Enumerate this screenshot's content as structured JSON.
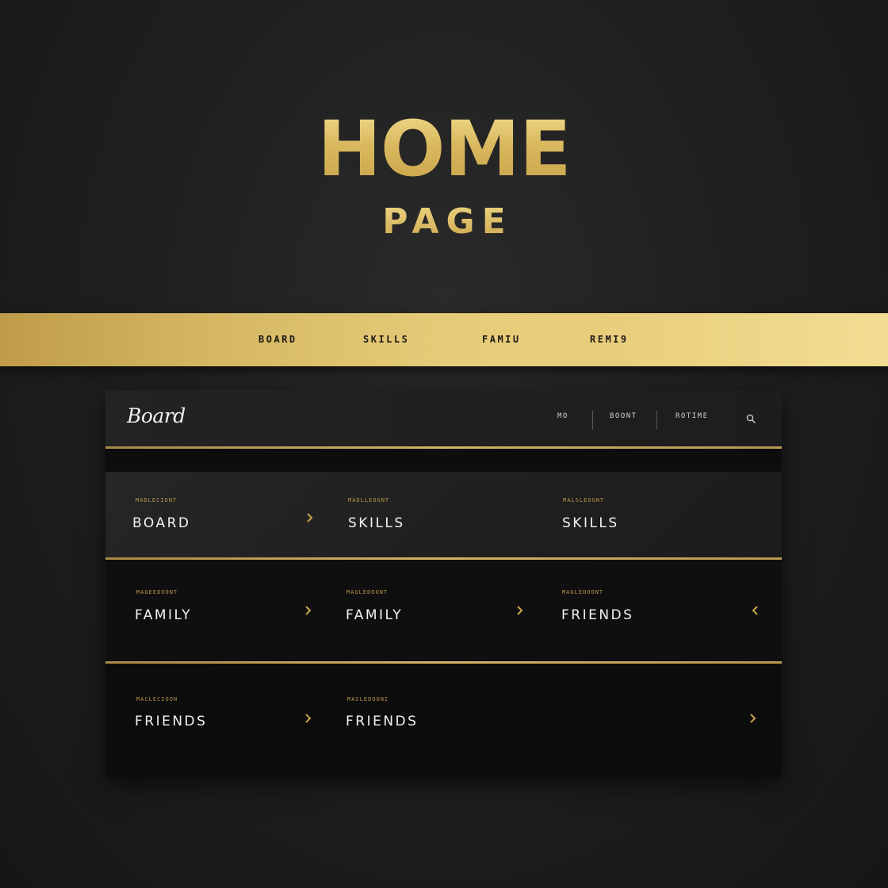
{
  "hero": {
    "title": "HOME",
    "subtitle": "PAGE"
  },
  "nav_band": {
    "items": [
      "BOARD",
      "SKILLS",
      "FAMIU",
      "REMI9"
    ]
  },
  "header": {
    "logo": "Board",
    "links": [
      "MO",
      "BOONT",
      "ROTIME"
    ],
    "search_icon": "search-icon"
  },
  "grid": {
    "rows": [
      [
        {
          "kicker": "MADLECIONT",
          "label": "BOARD"
        },
        {
          "kicker": "MADLLEOGNT",
          "label": "SKILLS"
        },
        {
          "kicker": "MALSLEOGNT",
          "label": "SKILLS"
        }
      ],
      [
        {
          "kicker": "MAGEEDOONT",
          "label": "FAMILY"
        },
        {
          "kicker": "MAGLEDOONT",
          "label": "FAMILY"
        },
        {
          "kicker": "MAGLEDOONT",
          "label": "FRIENDS"
        }
      ],
      [
        {
          "kicker": "MACLECIOON",
          "label": "FRIENDS"
        },
        {
          "kicker": "MASLEDOONI",
          "label": "FRIENDS"
        }
      ]
    ]
  },
  "colors": {
    "background": "#1e1e1e",
    "gold": "#d6b863",
    "gold_accent": "#c9a44a",
    "panel": "#0d0d0d",
    "text": "#f3f3f3"
  },
  "icons": [
    "search-icon",
    "chevron-right-icon",
    "chevron-left-icon"
  ]
}
